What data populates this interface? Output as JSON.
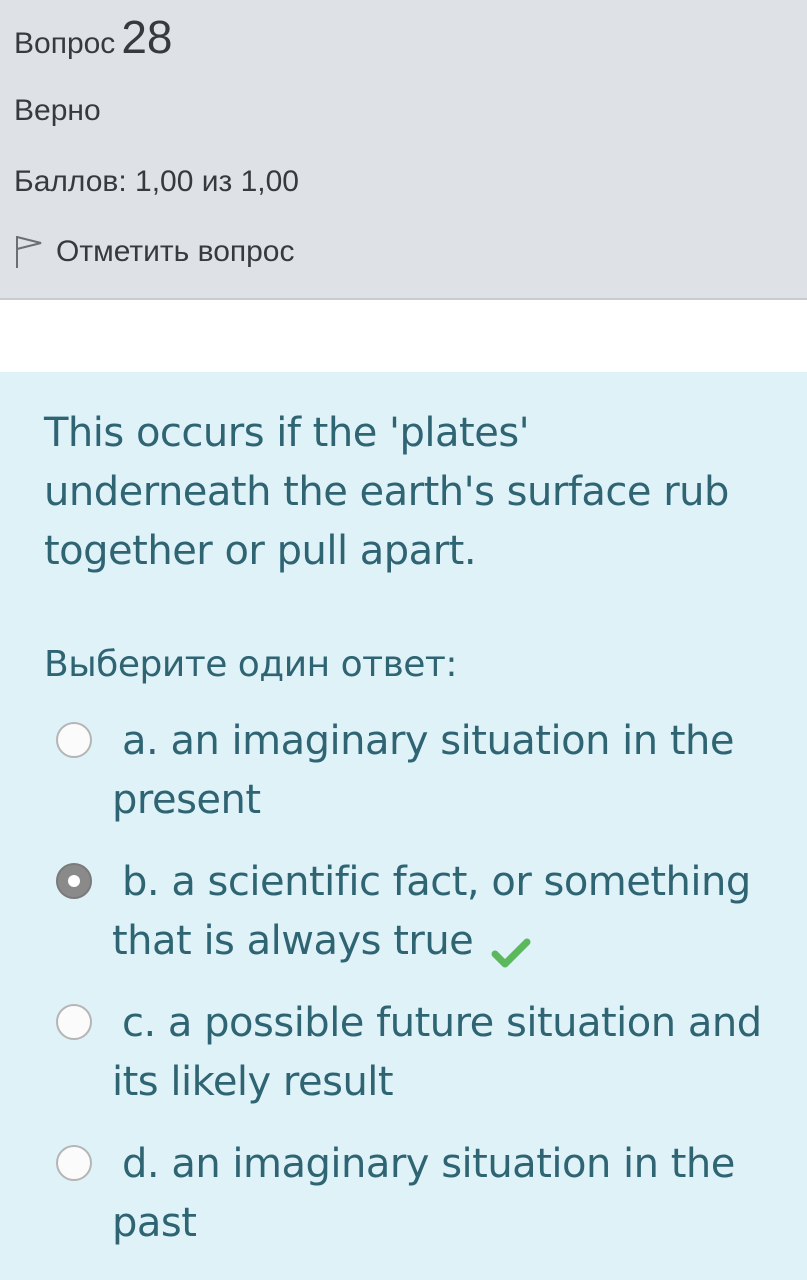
{
  "info": {
    "question_label": "Вопрос",
    "question_number": "28",
    "state": "Верно",
    "grade": "Баллов: 1,00 из 1,00",
    "flag_label": "Отметить вопрос"
  },
  "question": {
    "text": "This occurs if the 'plates' underneath the earth's surface rub together or pull apart.",
    "prompt": "Выберите один ответ:",
    "answers": [
      {
        "label": "a. an imaginary situation in the present",
        "checked": false
      },
      {
        "label": "b. a scientific fact, or something that is always true",
        "checked": true,
        "correct": true
      },
      {
        "label": "c. a possible future situation and its likely result",
        "checked": false
      },
      {
        "label": "d. an imaginary situation in the past",
        "checked": false
      }
    ]
  },
  "colors": {
    "info_bg": "#dee2e6",
    "content_bg": "#def2f8",
    "content_text": "#2f6473",
    "correct_check": "#5cb85c"
  }
}
